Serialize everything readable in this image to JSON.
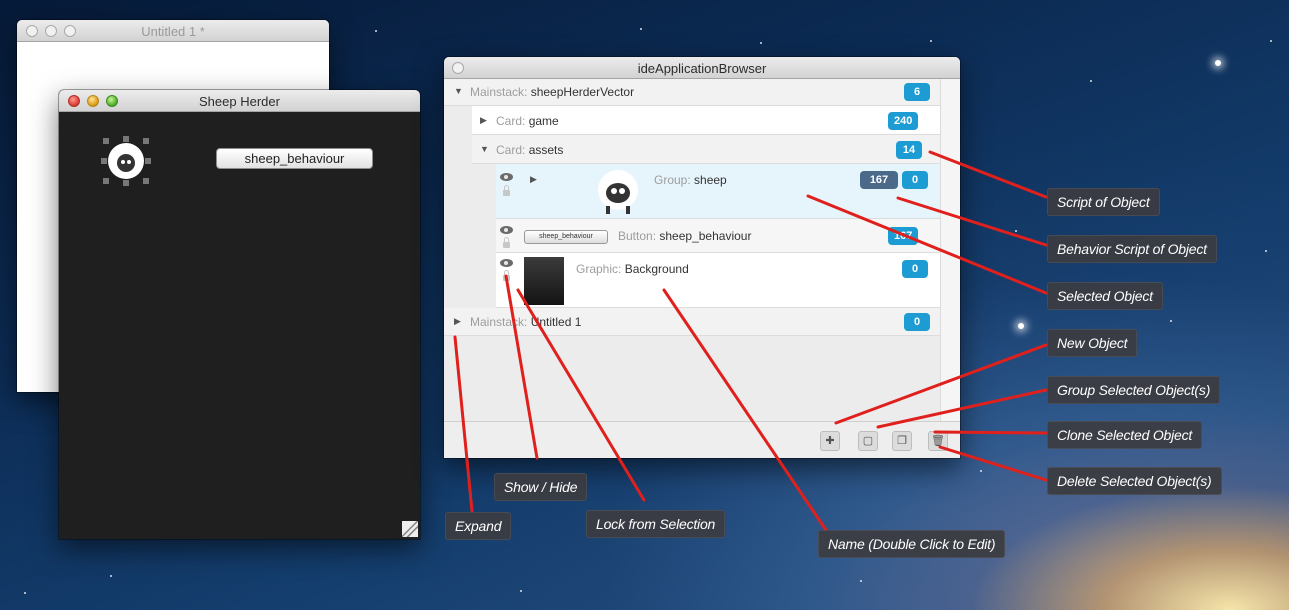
{
  "windows": {
    "untitled": {
      "title": "Untitled 1 *"
    },
    "sheep_herder": {
      "title": "Sheep Herder",
      "button_label": "sheep_behaviour"
    },
    "browser": {
      "title": "ideApplicationBrowser",
      "rows": [
        {
          "label": "Mainstack:",
          "value": "sheepHerderVector",
          "badge": "6"
        },
        {
          "label": "Card:",
          "value": "game",
          "badge": "240"
        },
        {
          "label": "Card:",
          "value": "assets",
          "badge": "14"
        },
        {
          "label": "Group:",
          "value": "sheep",
          "badge_dark": "167",
          "badge": "0"
        },
        {
          "label": "Button:",
          "value": "sheep_behaviour",
          "badge": "167",
          "thumb_label": "sheep_behaviour"
        },
        {
          "label": "Graphic:",
          "value": "Background",
          "badge": "0"
        },
        {
          "label": "Mainstack:",
          "value": "Untitled 1",
          "badge": "0"
        }
      ]
    }
  },
  "callouts": {
    "script_of_object": "Script of Object",
    "behavior_script": "Behavior Script of Object",
    "selected_object": "Selected Object",
    "new_object": "New Object",
    "group_selected": "Group Selected Object(s)",
    "clone_selected": "Clone Selected Object",
    "delete_selected": "Delete Selected Object(s)",
    "show_hide": "Show / Hide",
    "expand": "Expand",
    "lock_from_selection": "Lock from Selection",
    "name_edit": "Name (Double Click to Edit)"
  },
  "icons": {
    "arrow_color": "#e0201c",
    "badge_color": "#1d9bd3",
    "badge_dark_color": "#4b6a8a"
  }
}
